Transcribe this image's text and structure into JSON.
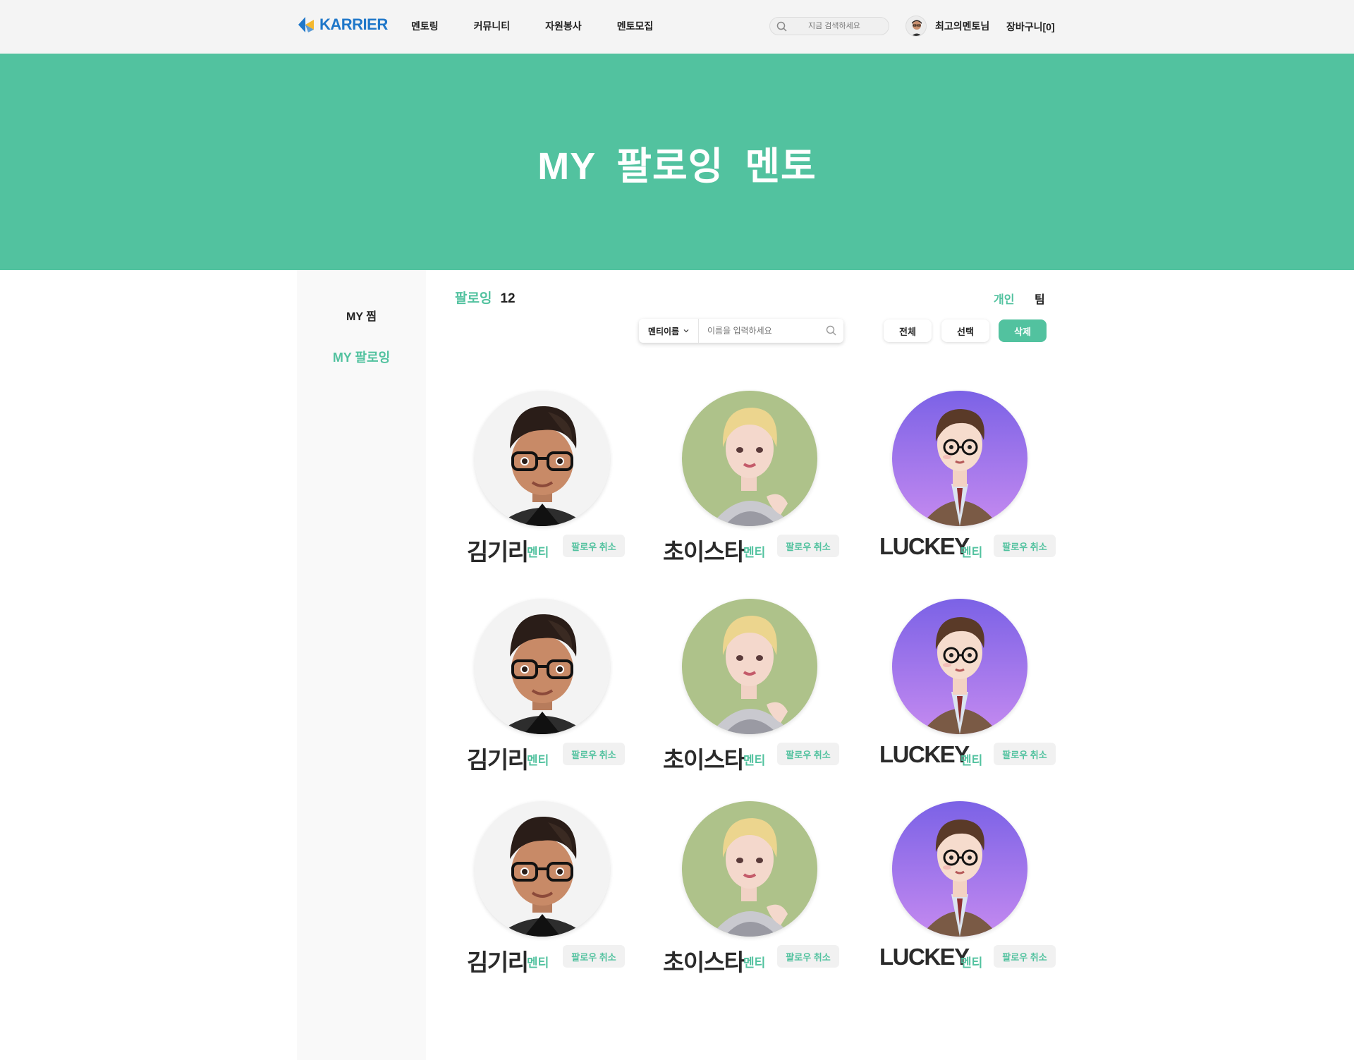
{
  "header": {
    "logo_text": "KARRIER",
    "nav": [
      "멘토링",
      "커뮤니티",
      "자원봉사",
      "멘토모집"
    ],
    "search_placeholder": "지금 검색하세요",
    "user_name": "최고의멘토님",
    "cart_label": "장바구니[0]"
  },
  "hero": {
    "title": "MY  팔로잉 멘토"
  },
  "sidebar": {
    "items": [
      "MY 찜",
      "MY 팔로잉"
    ]
  },
  "main": {
    "follow_label": "팔로잉",
    "follow_count": "12",
    "tabs": [
      "개인",
      "팀"
    ],
    "search_select": "멘티이름",
    "search_placeholder": "이름을 입력하세요",
    "buttons": {
      "all": "전체",
      "select": "선택",
      "delete": "삭제"
    },
    "cards": [
      {
        "name": "김기리",
        "role": "멘티",
        "action": "팔로우 취소",
        "avatar": "boy-glasses"
      },
      {
        "name": "초이스타",
        "role": "멘티",
        "action": "팔로우 취소",
        "avatar": "blonde-girl"
      },
      {
        "name": "LUCKEY",
        "role": "멘티",
        "action": "팔로우 취소",
        "avatar": "suit-boy"
      },
      {
        "name": "김기리",
        "role": "멘티",
        "action": "팔로우 취소",
        "avatar": "boy-glasses"
      },
      {
        "name": "초이스타",
        "role": "멘티",
        "action": "팔로우 취소",
        "avatar": "blonde-girl"
      },
      {
        "name": "LUCKEY",
        "role": "멘티",
        "action": "팔로우 취소",
        "avatar": "suit-boy"
      },
      {
        "name": "김기리",
        "role": "멘티",
        "action": "팔로우 취소",
        "avatar": "boy-glasses"
      },
      {
        "name": "초이스타",
        "role": "멘티",
        "action": "팔로우 취소",
        "avatar": "blonde-girl"
      },
      {
        "name": "LUCKEY",
        "role": "멘티",
        "action": "팔로우 취소",
        "avatar": "suit-boy"
      }
    ]
  },
  "colors": {
    "accent": "#52c29f",
    "brand": "#1f77c9",
    "header_bg": "#f4f4f4",
    "sidebar_bg": "#f9f9f9"
  }
}
